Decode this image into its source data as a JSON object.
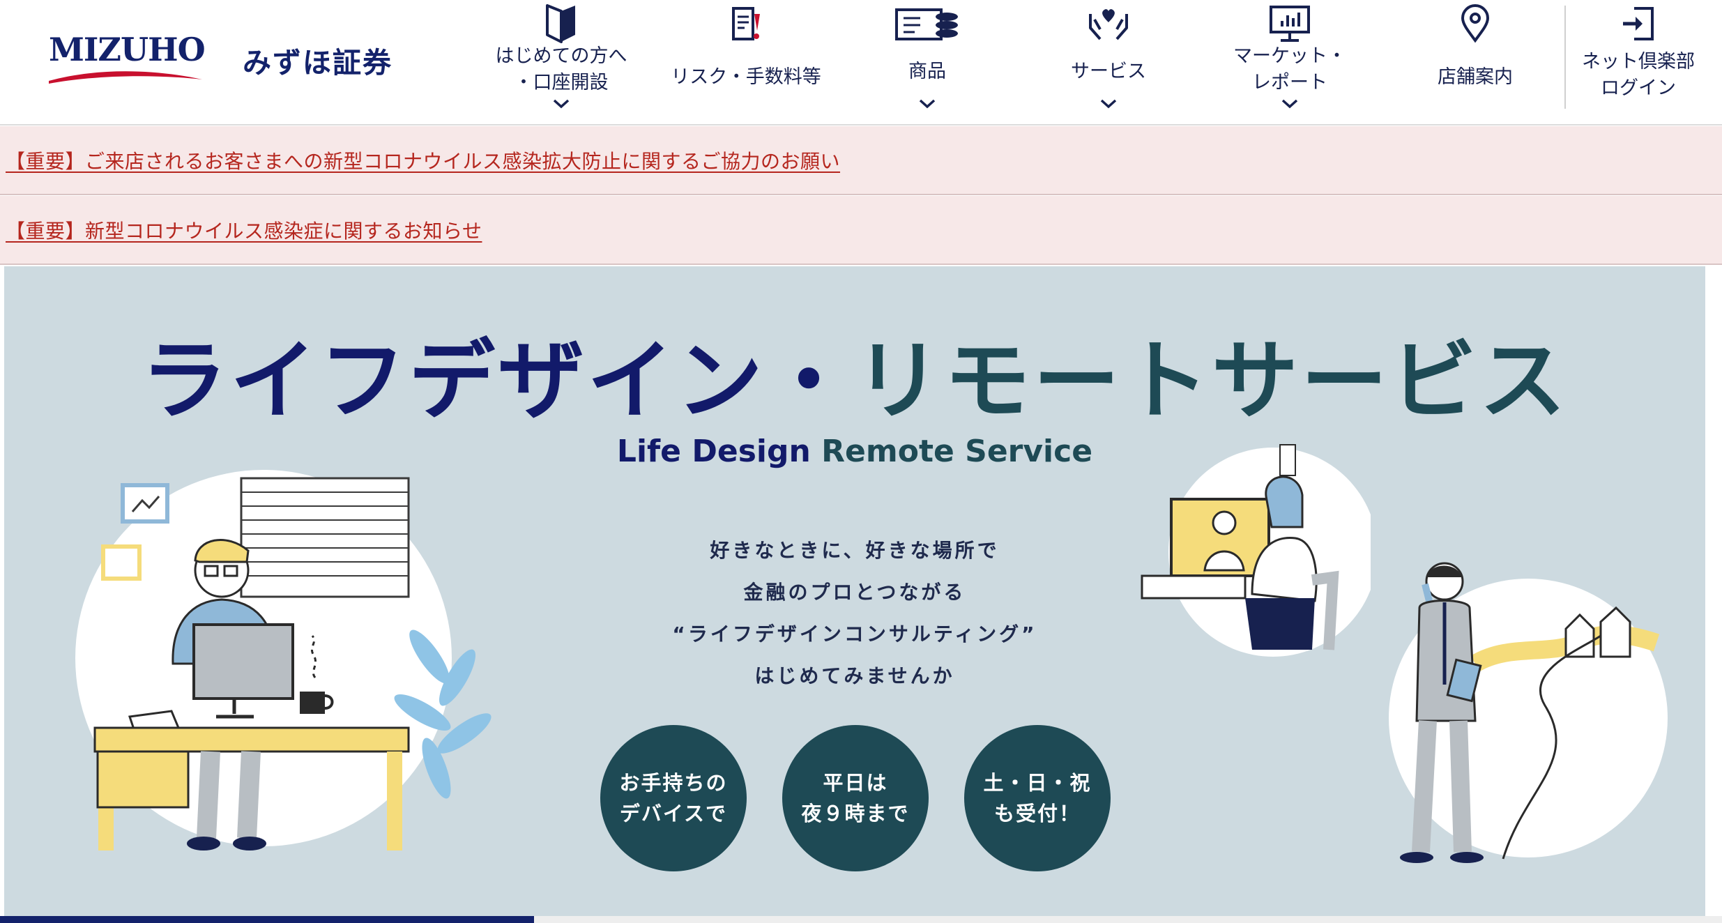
{
  "brand": {
    "logo_text": "MIZUHO",
    "name_jp": "みずほ証券"
  },
  "nav": [
    {
      "label": "はじめての方へ\n・口座開設",
      "icon": "beginner-leaf-icon",
      "has_dropdown": true
    },
    {
      "label": "リスク・手数料等",
      "icon": "document-alert-icon",
      "has_dropdown": false
    },
    {
      "label": "商品",
      "icon": "cash-coins-icon",
      "has_dropdown": true
    },
    {
      "label": "サービス",
      "icon": "hands-heart-icon",
      "has_dropdown": true
    },
    {
      "label": "マーケット・\nレポート",
      "icon": "monitor-chart-icon",
      "has_dropdown": true
    },
    {
      "label": "店舗案内",
      "icon": "map-pin-icon",
      "has_dropdown": false
    },
    {
      "label": "ネット倶楽部\nログイン",
      "icon": "login-icon",
      "has_dropdown": false
    }
  ],
  "notices": [
    {
      "text": "【重要】ご来店されるお客さまへの新型コロナウイルス感染拡大防止に関するご協力のお願い"
    },
    {
      "text": "【重要】新型コロナウイルス感染症に関するお知らせ"
    }
  ],
  "hero": {
    "title_part1": "ライフデザイン",
    "title_sep": "・",
    "title_part2": "リモートサービス",
    "subtitle_part1": "Life Design",
    "subtitle_part2": "Remote Service",
    "copy": [
      "好きなときに、好きな場所で",
      "金融のプロとつながる",
      "“ライフデザインコンサルティング”",
      "はじめてみませんか"
    ],
    "badges": [
      {
        "line1": "お手持ちの",
        "line2": "デバイスで"
      },
      {
        "line1": "平日は",
        "line2": "夜９時まで"
      },
      {
        "line1": "土・日・祝",
        "line2": "も受付！"
      }
    ]
  },
  "carousel": {
    "progress": 0.31
  },
  "colors": {
    "brand_navy": "#13226b",
    "brand_red": "#c8102e",
    "notice_bg": "#f7e8e8",
    "notice_text": "#b5261e",
    "hero_bg": "#cddae0",
    "hero_teal": "#1e4a55",
    "accent_yellow": "#f5dc7b"
  }
}
